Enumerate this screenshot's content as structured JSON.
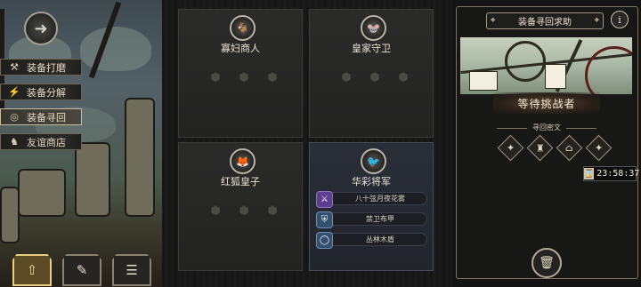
{
  "left": {
    "back_icon": "back-arrow-icon",
    "menu": [
      {
        "label": "装备打磨",
        "icon": "hammer-icon",
        "active": false
      },
      {
        "label": "装备分解",
        "icon": "decompose-icon",
        "active": false
      },
      {
        "label": "装备寻回",
        "icon": "retrieve-icon",
        "active": true
      },
      {
        "label": "友谊商店",
        "icon": "fox-shop-icon",
        "active": false
      }
    ],
    "bottom_buttons": [
      {
        "icon": "upload-arrow-icon",
        "active": true
      },
      {
        "icon": "feather-icon",
        "active": false
      },
      {
        "icon": "list-icon",
        "active": false
      }
    ]
  },
  "cards": [
    {
      "name": "寡妇商人",
      "portrait": "widow-merchant-portrait"
    },
    {
      "name": "皇家守卫",
      "portrait": "royal-guard-portrait"
    },
    {
      "name": "红狐皇子",
      "portrait": "red-fox-prince-portrait"
    },
    {
      "name": "华彩将军",
      "portrait": "gorgeous-general-portrait",
      "items": [
        {
          "label": "八十弦月夜花雾",
          "icon": "weapon-icon",
          "color": "#5c3f8c"
        },
        {
          "label": "禁卫布甲",
          "icon": "armor-icon",
          "color": "#33506e"
        },
        {
          "label": "丛林木盾",
          "icon": "ring-icon",
          "color": "#33506e"
        }
      ]
    }
  ],
  "right": {
    "title": "装备寻回求助",
    "status": "等待挑战者",
    "subtitle": "寻回密文",
    "timer": "23:58:37",
    "codes": [
      "pose-1-icon",
      "pose-2-icon",
      "pose-3-icon",
      "pose-4-icon"
    ]
  }
}
